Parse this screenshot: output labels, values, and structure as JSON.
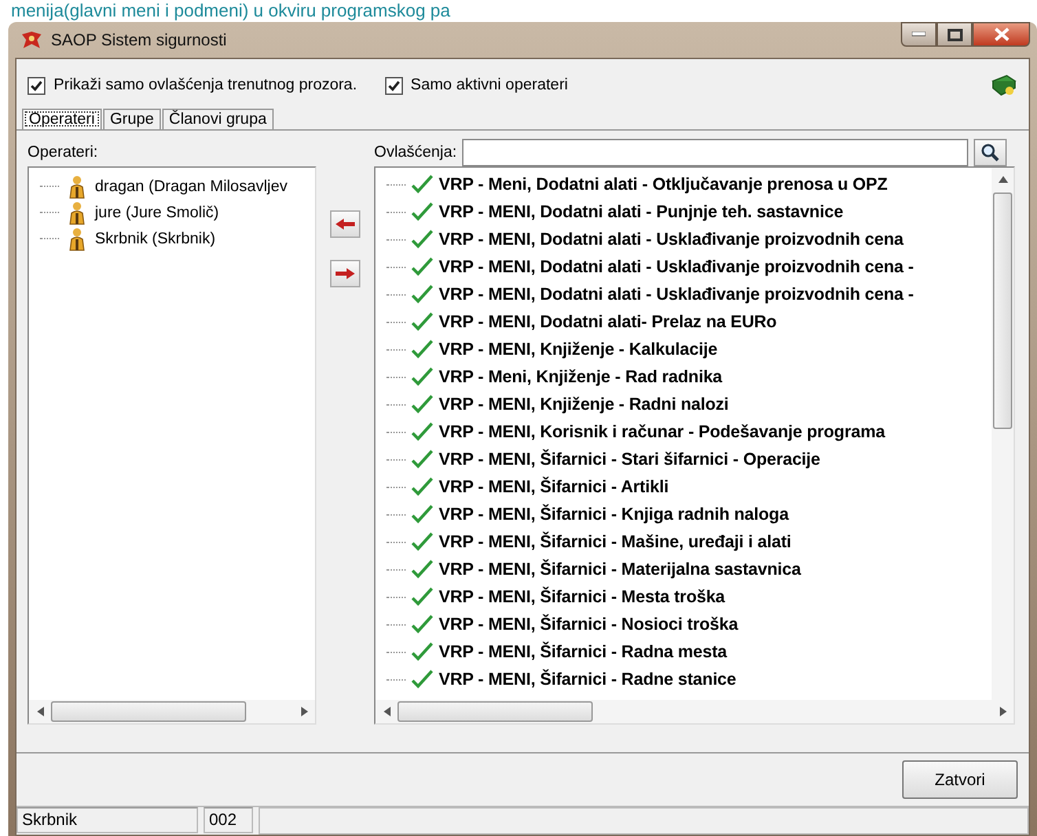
{
  "page_heading": "menija(glavni meni i podmeni) u okviru programskog pa",
  "window": {
    "title": "SAOP Sistem sigurnosti"
  },
  "options": [
    {
      "label": "Prikaži samo ovlašćenja trenutnog prozora.",
      "checked": true
    },
    {
      "label": "Samo aktivni operateri",
      "checked": true
    }
  ],
  "tabs": [
    {
      "label": "Operateri",
      "selected": true
    },
    {
      "label": "Grupe",
      "selected": false
    },
    {
      "label": "Članovi grupa",
      "selected": false
    }
  ],
  "operators": {
    "label": "Operateri:",
    "items": [
      {
        "label": "dragan (Dragan Milosavljev"
      },
      {
        "label": "jure (Jure Smolič)"
      },
      {
        "label": "Skrbnik (Skrbnik)"
      }
    ]
  },
  "permissions": {
    "label": "Ovlašćenja:",
    "items": [
      {
        "label": "VRP - Meni, Dodatni alati - Otključavanje prenosa u OPZ"
      },
      {
        "label": "VRP - MENI, Dodatni alati - Punjnje teh. sastavnice"
      },
      {
        "label": "VRP - MENI, Dodatni alati - Usklađivanje proizvodnih cena"
      },
      {
        "label": "VRP - MENI, Dodatni alati - Usklađivanje proizvodnih cena -"
      },
      {
        "label": "VRP - MENI, Dodatni alati - Usklađivanje proizvodnih cena -"
      },
      {
        "label": "VRP - MENI, Dodatni alati- Prelaz na EURo"
      },
      {
        "label": "VRP - MENI, Knjiženje - Kalkulacije"
      },
      {
        "label": "VRP - Meni, Knjiženje - Rad radnika"
      },
      {
        "label": "VRP - MENI, Knjiženje - Radni nalozi"
      },
      {
        "label": "VRP - MENI, Korisnik i računar - Podešavanje programa"
      },
      {
        "label": "VRP - MENI, Šifarnici  - Stari šifarnici - Operacije"
      },
      {
        "label": "VRP - MENI, Šifarnici - Artikli"
      },
      {
        "label": "VRP - MENI, Šifarnici - Knjiga radnih naloga"
      },
      {
        "label": "VRP - MENI, Šifarnici - Mašine, uređaji i alati"
      },
      {
        "label": "VRP - MENI, Šifarnici - Materijalna sastavnica"
      },
      {
        "label": "VRP - MENI, Šifarnici - Mesta troška"
      },
      {
        "label": "VRP - MENI, Šifarnici - Nosioci troška"
      },
      {
        "label": "VRP - MENI, Šifarnici - Radna mesta"
      },
      {
        "label": "VRP - MENI, Šifarnici - Radne stanice"
      }
    ]
  },
  "buttons": [
    "Zatvori"
  ],
  "status_bar": [
    "Skrbnik",
    "002"
  ]
}
